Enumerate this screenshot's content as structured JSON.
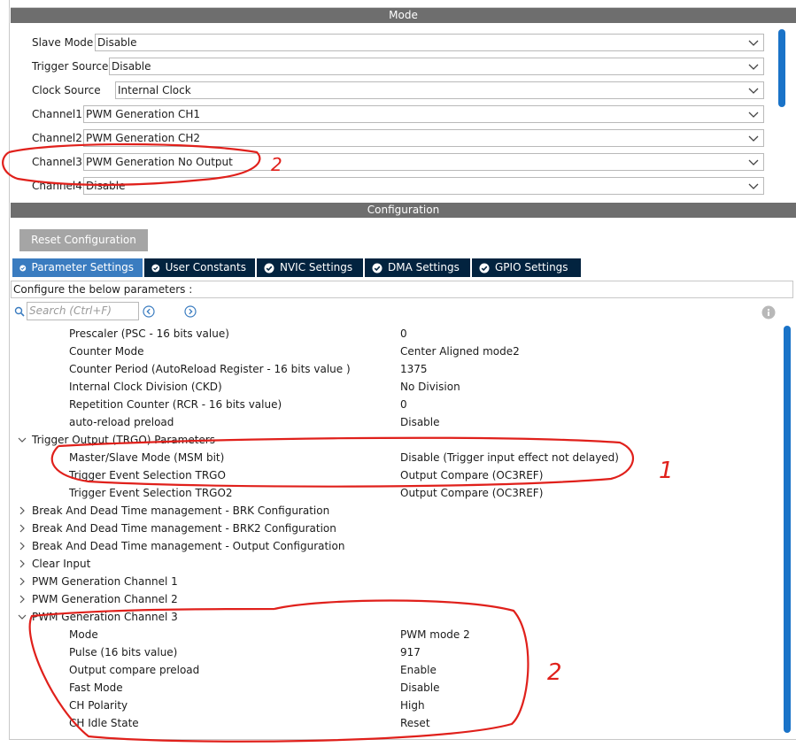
{
  "mode_header": "Mode",
  "config_header": "Configuration",
  "mode_rows": [
    {
      "label": "Slave Mode",
      "value": "Disable"
    },
    {
      "label": "Trigger Source",
      "value": "Disable"
    },
    {
      "label": "Clock Source",
      "value": "Internal Clock"
    },
    {
      "label": "Channel1",
      "value": "PWM Generation CH1"
    },
    {
      "label": "Channel2",
      "value": "PWM Generation CH2"
    },
    {
      "label": "Channel3",
      "value": "PWM Generation No Output"
    },
    {
      "label": "Channel4",
      "value": "Disable"
    }
  ],
  "reset_button": "Reset Configuration",
  "tabs": [
    {
      "label": "Parameter Settings",
      "icon": "check-circle-icon",
      "active": true
    },
    {
      "label": "User Constants",
      "icon": "check-circle-icon",
      "active": false
    },
    {
      "label": "NVIC Settings",
      "icon": "check-circle-icon",
      "active": false
    },
    {
      "label": "DMA Settings",
      "icon": "check-circle-icon",
      "active": false
    },
    {
      "label": "GPIO Settings",
      "icon": "check-circle-icon",
      "active": false
    }
  ],
  "configure_text": "Configure the below parameters :",
  "search": {
    "placeholder": "Search (Ctrl+F)"
  },
  "params": [
    {
      "kind": "param",
      "name": "Prescaler (PSC - 16 bits value)",
      "value": "0"
    },
    {
      "kind": "param",
      "name": "Counter Mode",
      "value": "Center Aligned mode2"
    },
    {
      "kind": "param",
      "name": "Counter Period (AutoReload Register - 16 bits value )",
      "value": "1375"
    },
    {
      "kind": "param",
      "name": "Internal Clock Division (CKD)",
      "value": "No Division"
    },
    {
      "kind": "param",
      "name": "Repetition Counter (RCR - 16 bits value)",
      "value": "0"
    },
    {
      "kind": "param",
      "name": "auto-reload preload",
      "value": "Disable"
    },
    {
      "kind": "group",
      "name": "Trigger Output (TRGO) Parameters",
      "expanded": true
    },
    {
      "kind": "param",
      "name": "Master/Slave Mode (MSM bit)",
      "value": "Disable (Trigger input effect not delayed)"
    },
    {
      "kind": "param",
      "name": "Trigger Event Selection TRGO",
      "value": "Output Compare (OC3REF)"
    },
    {
      "kind": "param",
      "name": "Trigger Event Selection TRGO2",
      "value": "Output Compare (OC3REF)"
    },
    {
      "kind": "group",
      "name": "Break And Dead Time management - BRK Configuration",
      "expanded": false
    },
    {
      "kind": "group",
      "name": "Break And Dead Time management - BRK2 Configuration",
      "expanded": false
    },
    {
      "kind": "group",
      "name": "Break And Dead Time management - Output Configuration",
      "expanded": false
    },
    {
      "kind": "group",
      "name": "Clear Input",
      "expanded": false
    },
    {
      "kind": "group",
      "name": "PWM Generation Channel 1",
      "expanded": false
    },
    {
      "kind": "group",
      "name": "PWM Generation Channel 2",
      "expanded": false
    },
    {
      "kind": "group",
      "name": "PWM Generation Channel 3",
      "expanded": true
    },
    {
      "kind": "param",
      "name": "Mode",
      "value": "PWM mode 2"
    },
    {
      "kind": "param",
      "name": "Pulse (16 bits value)",
      "value": "917"
    },
    {
      "kind": "param",
      "name": "Output compare preload",
      "value": "Enable"
    },
    {
      "kind": "param",
      "name": "Fast Mode",
      "value": "Disable"
    },
    {
      "kind": "param",
      "name": "CH Polarity",
      "value": "High"
    },
    {
      "kind": "param",
      "name": "CH Idle State",
      "value": "Reset"
    }
  ],
  "annotations": [
    "2",
    "1",
    "2"
  ],
  "colors": {
    "tab_bg": "#02233f",
    "tab_active": "#3a7cc0",
    "header_bg": "#6e6e6e",
    "annotation": "#e0201b",
    "scrollbar": "#1a73c8"
  }
}
